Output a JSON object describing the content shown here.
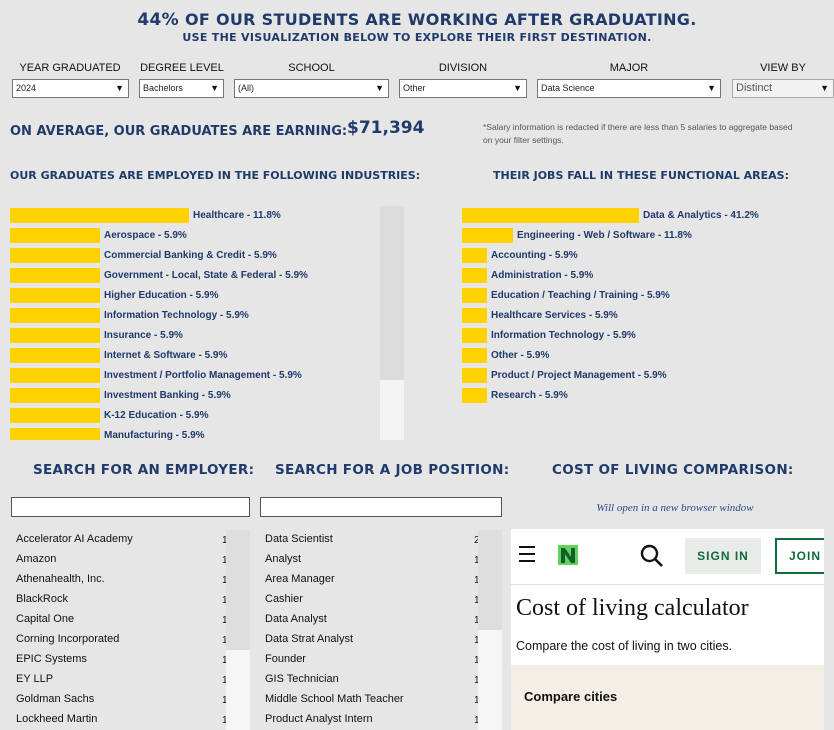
{
  "header": {
    "percent": "44%",
    "headline": "OF OUR STUDENTS ARE WORKING AFTER GRADUATING.",
    "subline": "USE THE VISUALIZATION BELOW TO EXPLORE THEIR FIRST DESTINATION."
  },
  "filters": {
    "year": {
      "label": "YEAR GRADUATED",
      "value": "2024"
    },
    "degree": {
      "label": "DEGREE LEVEL",
      "value": "Bachelors"
    },
    "school": {
      "label": "SCHOOL",
      "value": "(All)"
    },
    "division": {
      "label": "DIVISION",
      "value": "Other"
    },
    "major": {
      "label": "MAJOR",
      "value": "Data Science"
    },
    "viewby": {
      "label": "VIEW BY",
      "value": "Distinct"
    }
  },
  "salary": {
    "label": "ON AVERAGE, OUR GRADUATES ARE EARNING:",
    "value": "$71,394",
    "note": "*Salary information is redacted if there are less than 5 salaries to aggregate based on your filter settings."
  },
  "industries": {
    "title": "OUR GRADUATES ARE EMPLOYED IN THE FOLLOWING INDUSTRIES:",
    "items": [
      {
        "label": "Healthcare - 11.8%",
        "value": 11.8
      },
      {
        "label": "Aerospace - 5.9%",
        "value": 5.9
      },
      {
        "label": "Commercial Banking & Credit - 5.9%",
        "value": 5.9
      },
      {
        "label": "Government - Local, State & Federal - 5.9%",
        "value": 5.9
      },
      {
        "label": "Higher Education - 5.9%",
        "value": 5.9
      },
      {
        "label": "Information Technology - 5.9%",
        "value": 5.9
      },
      {
        "label": "Insurance - 5.9%",
        "value": 5.9
      },
      {
        "label": "Internet & Software - 5.9%",
        "value": 5.9
      },
      {
        "label": "Investment / Portfolio Management - 5.9%",
        "value": 5.9
      },
      {
        "label": "Investment Banking - 5.9%",
        "value": 5.9
      },
      {
        "label": "K-12 Education - 5.9%",
        "value": 5.9
      },
      {
        "label": "Manufacturing - 5.9%",
        "value": 5.9
      }
    ]
  },
  "functions": {
    "title": "THEIR JOBS FALL IN THESE FUNCTIONAL AREAS:",
    "items": [
      {
        "label": "Data & Analytics - 41.2%",
        "value": 41.2
      },
      {
        "label": "Engineering - Web / Software - 11.8%",
        "value": 11.8
      },
      {
        "label": "Accounting - 5.9%",
        "value": 5.9
      },
      {
        "label": "Administration - 5.9%",
        "value": 5.9
      },
      {
        "label": "Education / Teaching / Training - 5.9%",
        "value": 5.9
      },
      {
        "label": "Healthcare Services - 5.9%",
        "value": 5.9
      },
      {
        "label": "Information Technology - 5.9%",
        "value": 5.9
      },
      {
        "label": "Other - 5.9%",
        "value": 5.9
      },
      {
        "label": "Product / Project Management - 5.9%",
        "value": 5.9
      },
      {
        "label": "Research - 5.9%",
        "value": 5.9
      }
    ]
  },
  "employer_search": {
    "title": "SEARCH FOR AN EMPLOYER:",
    "items": [
      {
        "name": "Accelerator AI Academy",
        "count": "1"
      },
      {
        "name": "Amazon",
        "count": "1"
      },
      {
        "name": "Athenahealth, Inc.",
        "count": "1"
      },
      {
        "name": "BlackRock",
        "count": "1"
      },
      {
        "name": "Capital One",
        "count": "1"
      },
      {
        "name": "Corning Incorporated",
        "count": "1"
      },
      {
        "name": "EPIC Systems",
        "count": "1"
      },
      {
        "name": "EY LLP",
        "count": "1"
      },
      {
        "name": "Goldman Sachs",
        "count": "1"
      },
      {
        "name": "Lockheed Martin",
        "count": "1"
      }
    ]
  },
  "job_search": {
    "title": "SEARCH FOR A JOB POSITION:",
    "items": [
      {
        "name": "Data Scientist",
        "count": "2"
      },
      {
        "name": "Analyst",
        "count": "1"
      },
      {
        "name": "Area Manager",
        "count": "1"
      },
      {
        "name": "Cashier",
        "count": "1"
      },
      {
        "name": "Data Analyst",
        "count": "1"
      },
      {
        "name": "Data Strat Analyst",
        "count": "1"
      },
      {
        "name": "Founder",
        "count": "1"
      },
      {
        "name": "GIS Technician",
        "count": "1"
      },
      {
        "name": "Middle School Math Teacher",
        "count": "1"
      },
      {
        "name": "Product Analyst Intern",
        "count": "1"
      }
    ]
  },
  "cost_of_living": {
    "title": "COST OF LIVING COMPARISON:",
    "note": "Will open in a new browser window",
    "embed": {
      "signin": "SIGN IN",
      "join": "JOIN",
      "title": "Cost of living calculator",
      "subtitle": "Compare the cost of living in two cities.",
      "compare_label": "Compare cities"
    }
  },
  "colors": {
    "navy": "#1f3a6b",
    "bar": "#ffd200",
    "brand_green": "#0f6b3a"
  }
}
